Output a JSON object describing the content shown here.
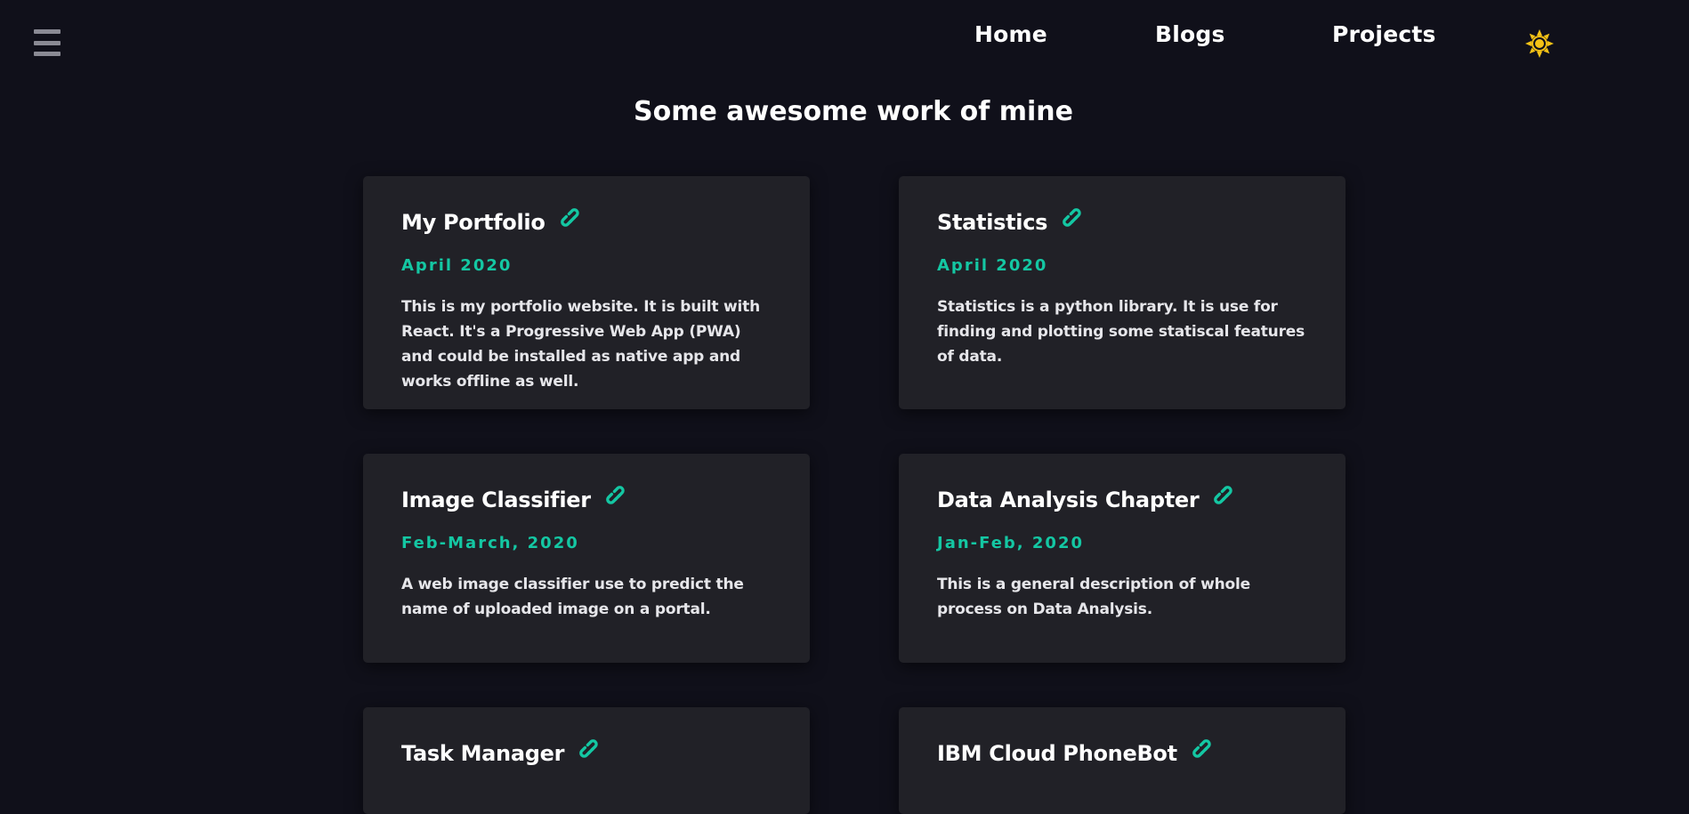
{
  "nav": {
    "links": [
      "Home",
      "Blogs",
      "Projects"
    ]
  },
  "icons": {
    "menu": "hamburger-menu-icon",
    "theme": "sun-icon",
    "project_link": "link-icon"
  },
  "colors": {
    "background": "#10101a",
    "card": "#212127",
    "accent": "#14c7a3",
    "sun": "#f5c216"
  },
  "page": {
    "title": "Some awesome work of mine"
  },
  "projects": [
    {
      "title": "My Portfolio",
      "date": "April 2020",
      "description": "This is my portfolio website. It is built with React. It's a Progressive Web App (PWA) and could be installed as native app and works offline as well."
    },
    {
      "title": "Statistics",
      "date": "April 2020",
      "description": "Statistics is a python library. It is use for finding and plotting some statiscal features of data."
    },
    {
      "title": "Image Classifier",
      "date": "Feb-March, 2020",
      "description": "A web image classifier use to predict the name of uploaded image on a portal."
    },
    {
      "title": "Data Analysis Chapter",
      "date": "Jan-Feb, 2020",
      "description": "This is a general description of whole process on Data Analysis."
    },
    {
      "title": "Task Manager"
    },
    {
      "title": "IBM Cloud PhoneBot"
    }
  ]
}
